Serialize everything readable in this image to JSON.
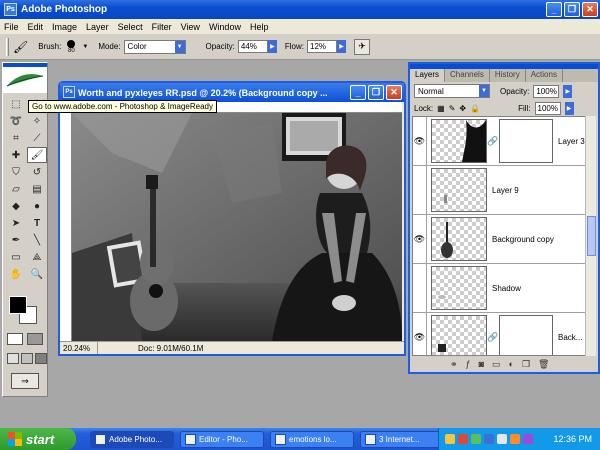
{
  "app": {
    "title": "Adobe Photoshop"
  },
  "menu": [
    "File",
    "Edit",
    "Image",
    "Layer",
    "Select",
    "Filter",
    "View",
    "Window",
    "Help"
  ],
  "options_bar": {
    "brush_label": "Brush:",
    "brush_size": "80",
    "mode_label": "Mode:",
    "mode_value": "Color",
    "opacity_label": "Opacity:",
    "opacity_value": "44%",
    "flow_label": "Flow:",
    "flow_value": "12%"
  },
  "tooltip": "Go to www.adobe.com - Photoshop & ImageReady",
  "document": {
    "title": "Worth and pyxleyes RR.psd @ 20.2% (Background copy ...",
    "zoom": "20.24%",
    "info": "Doc: 9.01M/60.1M"
  },
  "layers_palette": {
    "tabs": [
      "Layers",
      "Channels",
      "History",
      "Actions"
    ],
    "active_tab": "Layers",
    "blend_mode": "Normal",
    "opacity_label": "Opacity:",
    "opacity_value": "100%",
    "lock_label": "Lock:",
    "fill_label": "Fill:",
    "fill_value": "100%",
    "layers": [
      {
        "name": "Layer 3",
        "visible": true,
        "has_mask": true
      },
      {
        "name": "Layer 9",
        "visible": false,
        "has_mask": false
      },
      {
        "name": "Background copy",
        "visible": true,
        "has_mask": false
      },
      {
        "name": "Shadow",
        "visible": false,
        "has_mask": false
      },
      {
        "name": "Back...",
        "visible": true,
        "has_mask": true
      }
    ]
  },
  "taskbar": {
    "start_label": "start",
    "tasks": [
      {
        "label": "Adobe Photo...",
        "active": true
      },
      {
        "label": "Editor - Pho...",
        "active": false
      },
      {
        "label": "emotions lo...",
        "active": false
      },
      {
        "label": "3 Internet...",
        "active": false
      }
    ],
    "clock": "12:36 PM"
  }
}
